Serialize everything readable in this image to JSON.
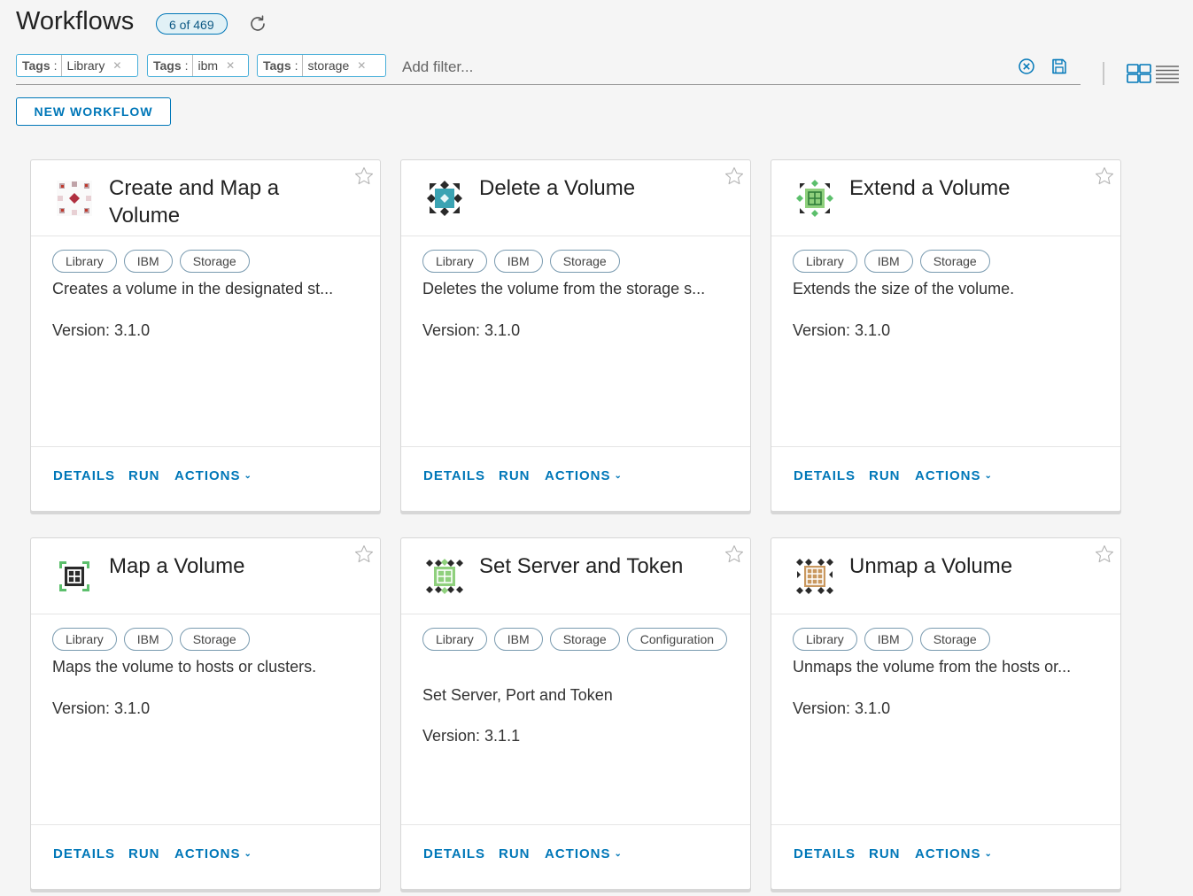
{
  "header": {
    "title": "Workflows",
    "count": "6 of 469"
  },
  "filters": {
    "tags": [
      {
        "key": "Tags",
        "value": "Library"
      },
      {
        "key": "Tags",
        "value": "ibm"
      },
      {
        "key": "Tags",
        "value": "storage"
      }
    ],
    "placeholder": "Add filter..."
  },
  "new_button": "NEW WORKFLOW",
  "footer_labels": {
    "details": "DETAILS",
    "run": "RUN",
    "actions": "ACTIONS"
  },
  "cards": [
    {
      "title": "Create and Map a Volume",
      "labels": [
        "Library",
        "IBM",
        "Storage"
      ],
      "description": "Creates a volume in the designated st...",
      "version": "Version: 3.1.0",
      "icon": "create-map-volume-icon"
    },
    {
      "title": "Delete a Volume",
      "labels": [
        "Library",
        "IBM",
        "Storage"
      ],
      "description": "Deletes the volume from the storage s...",
      "version": "Version: 3.1.0",
      "icon": "delete-volume-icon"
    },
    {
      "title": "Extend a Volume",
      "labels": [
        "Library",
        "IBM",
        "Storage"
      ],
      "description": "Extends the size of the volume.",
      "version": "Version: 3.1.0",
      "icon": "extend-volume-icon"
    },
    {
      "title": "Map a Volume",
      "labels": [
        "Library",
        "IBM",
        "Storage"
      ],
      "description": "Maps the volume to hosts or clusters.",
      "version": "Version: 3.1.0",
      "icon": "map-volume-icon"
    },
    {
      "title": "Set Server and Token",
      "labels": [
        "Library",
        "IBM",
        "Storage",
        "Configuration"
      ],
      "description": "Set Server, Port and Token",
      "version": "Version: 3.1.1",
      "icon": "set-server-token-icon"
    },
    {
      "title": "Unmap a Volume",
      "labels": [
        "Library",
        "IBM",
        "Storage"
      ],
      "description": "Unmaps the volume from the hosts or...",
      "version": "Version: 3.1.0",
      "icon": "unmap-volume-icon"
    }
  ],
  "colors": {
    "accent": "#0077b8",
    "badge_bg": "#e1f1f6",
    "tag_border": "#49afd9"
  }
}
